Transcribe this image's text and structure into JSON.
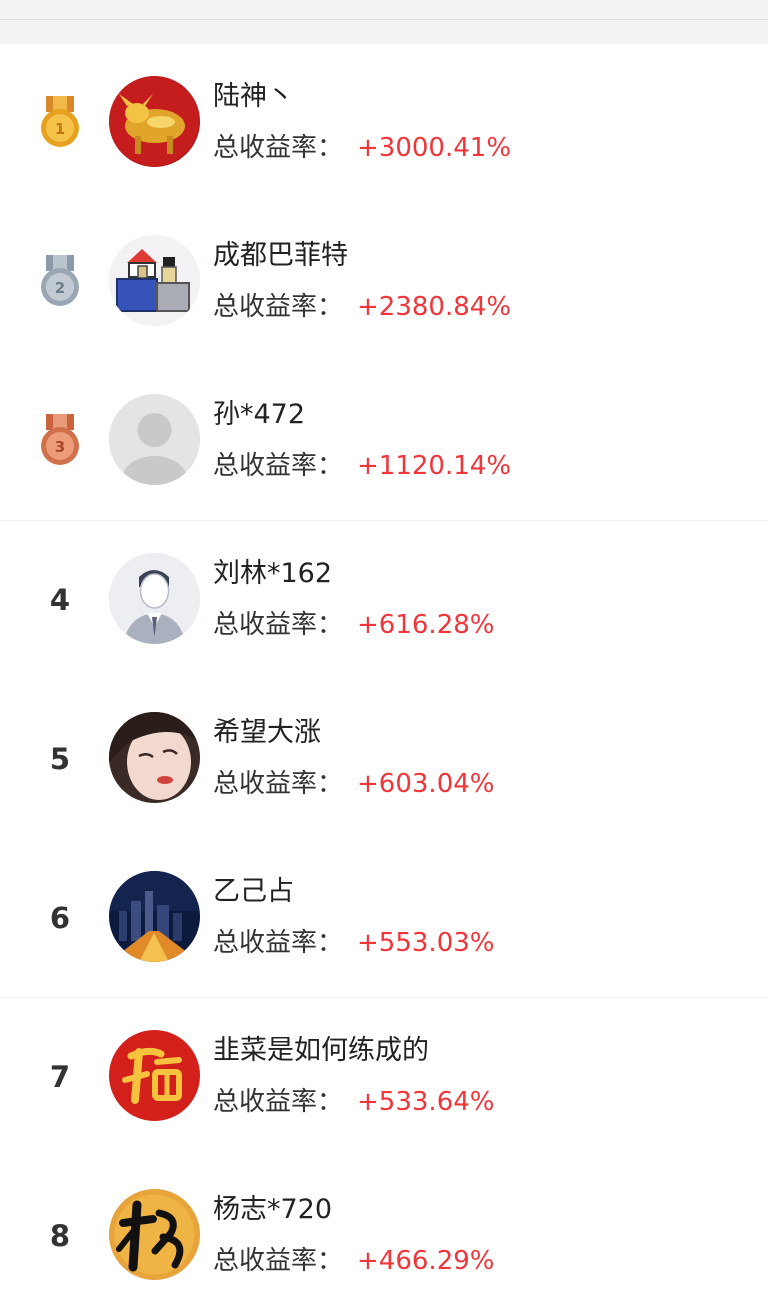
{
  "ranking": {
    "yield_label": "总收益率：",
    "accent_color": "#f0353b",
    "entries": [
      {
        "rank": "1",
        "name": "陆神丶",
        "yield": "+3000.41%",
        "badge": "gold-medal"
      },
      {
        "rank": "2",
        "name": "成都巴菲特",
        "yield": "+2380.84%",
        "badge": "silver-medal"
      },
      {
        "rank": "3",
        "name": "孙*472",
        "yield": "+1120.14%",
        "badge": "bronze-medal"
      },
      {
        "rank": "4",
        "name": "刘林*162",
        "yield": "+616.28%"
      },
      {
        "rank": "5",
        "name": "希望大涨",
        "yield": "+603.04%"
      },
      {
        "rank": "6",
        "name": "乙己占",
        "yield": "+553.03%"
      },
      {
        "rank": "7",
        "name": "韭菜是如何练成的",
        "yield": "+533.64%"
      },
      {
        "rank": "8",
        "name": "杨志*720",
        "yield": "+466.29%"
      }
    ]
  }
}
